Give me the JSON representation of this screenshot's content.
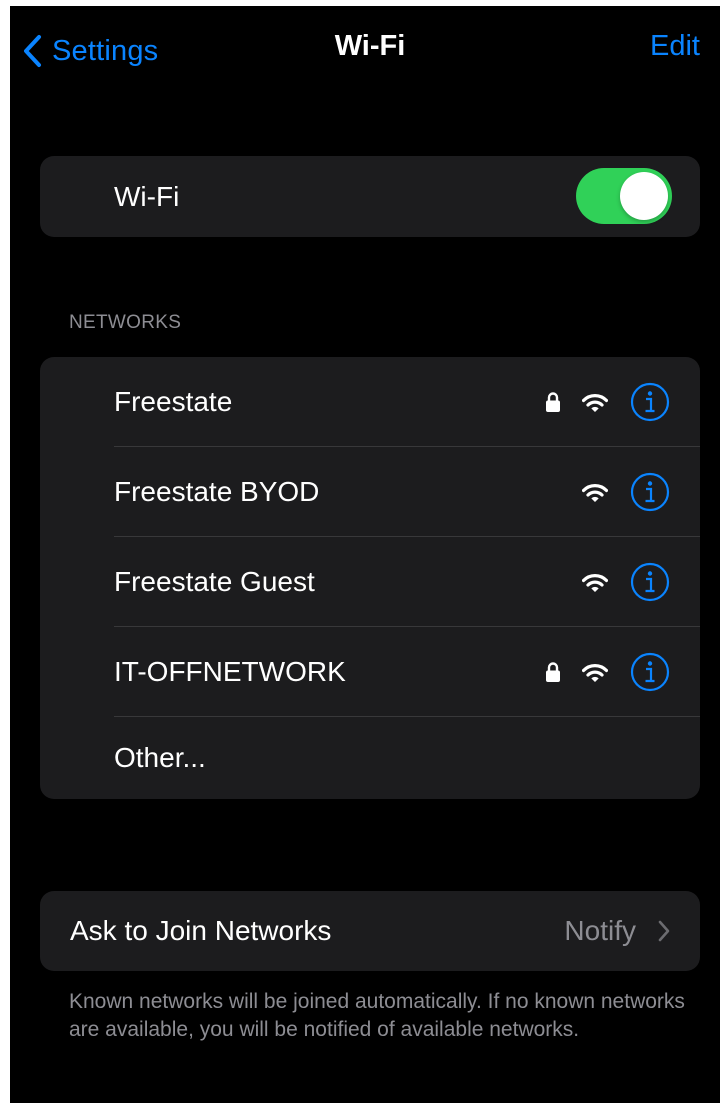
{
  "nav": {
    "back_label": "Settings",
    "title": "Wi-Fi",
    "edit_label": "Edit"
  },
  "wifi": {
    "label": "Wi-Fi",
    "enabled": true
  },
  "networks": {
    "header": "NETWORKS",
    "items": [
      {
        "name": "Freestate",
        "secured": true,
        "signal_icon": "wifi-icon",
        "info_icon": "info-icon"
      },
      {
        "name": "Freestate BYOD",
        "secured": false,
        "signal_icon": "wifi-icon",
        "info_icon": "info-icon"
      },
      {
        "name": "Freestate Guest",
        "secured": false,
        "signal_icon": "wifi-icon",
        "info_icon": "info-icon"
      },
      {
        "name": "IT-OFFNETWORK",
        "secured": true,
        "signal_icon": "wifi-icon",
        "info_icon": "info-icon"
      }
    ],
    "other_label": "Other..."
  },
  "ask_to_join": {
    "label": "Ask to Join Networks",
    "value": "Notify",
    "footer": "Known networks will be joined automatically. If no known networks are available, you will be notified of available networks."
  },
  "colors": {
    "accent": "#0a84ff",
    "toggle_on": "#30d158",
    "card_bg": "#1c1c1e",
    "secondary_text": "#8d8d93",
    "separator": "#38383a"
  }
}
